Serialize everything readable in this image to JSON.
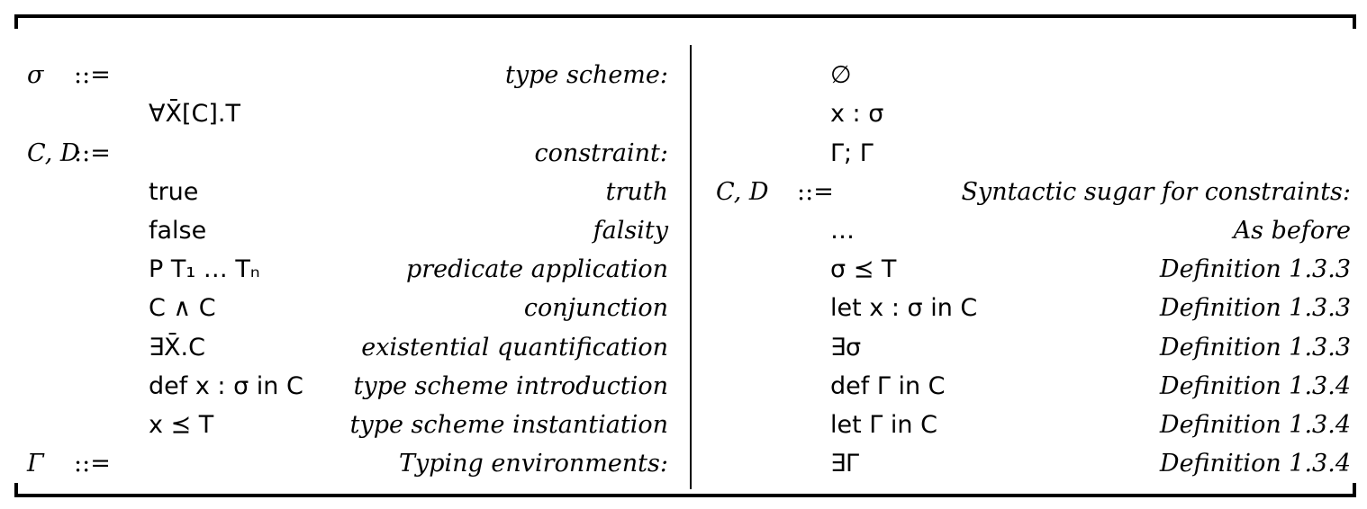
{
  "left": {
    "rows": [
      {
        "sym": "σ",
        "eq": "::=",
        "prod": "",
        "desc": "type scheme:"
      },
      {
        "sym": "",
        "eq": "",
        "prod": "∀X̄[C].T",
        "desc": ""
      },
      {
        "sym": "C, D",
        "eq": "::=",
        "prod": "",
        "desc": "constraint:"
      },
      {
        "sym": "",
        "eq": "",
        "prod": "true",
        "desc": "truth"
      },
      {
        "sym": "",
        "eq": "",
        "prod": "false",
        "desc": "falsity"
      },
      {
        "sym": "",
        "eq": "",
        "prod": "P T₁ … Tₙ",
        "desc": "predicate application"
      },
      {
        "sym": "",
        "eq": "",
        "prod": "C ∧ C",
        "desc": "conjunction"
      },
      {
        "sym": "",
        "eq": "",
        "prod": "∃X̄.C",
        "desc": "existential quantification"
      },
      {
        "sym": "",
        "eq": "",
        "prod": "def x : σ in C",
        "desc": "type scheme introduction"
      },
      {
        "sym": "",
        "eq": "",
        "prod": "x ⪯ T",
        "desc": "type scheme instantiation"
      },
      {
        "sym": "Γ",
        "eq": "::=",
        "prod": "",
        "desc": "Typing environments:"
      }
    ]
  },
  "right": {
    "rows": [
      {
        "sym": "",
        "eq": "",
        "prod": "∅",
        "desc": ""
      },
      {
        "sym": "",
        "eq": "",
        "prod": "x : σ",
        "desc": ""
      },
      {
        "sym": "",
        "eq": "",
        "prod": "Γ; Γ",
        "desc": ""
      },
      {
        "sym": "C, D",
        "eq": "::=",
        "prod": "",
        "desc": "Syntactic sugar for constraints:"
      },
      {
        "sym": "",
        "eq": "",
        "prod": "…",
        "desc": "As before"
      },
      {
        "sym": "",
        "eq": "",
        "prod": "σ ⪯ T",
        "desc": "Definition 1.3.3"
      },
      {
        "sym": "",
        "eq": "",
        "prod": "let x : σ in C",
        "desc": "Definition 1.3.3"
      },
      {
        "sym": "",
        "eq": "",
        "prod": "∃σ",
        "desc": "Definition 1.3.3"
      },
      {
        "sym": "",
        "eq": "",
        "prod": "def Γ in C",
        "desc": "Definition 1.3.4"
      },
      {
        "sym": "",
        "eq": "",
        "prod": "let Γ in C",
        "desc": "Definition 1.3.4"
      },
      {
        "sym": "",
        "eq": "",
        "prod": "∃Γ",
        "desc": "Definition 1.3.4"
      }
    ]
  }
}
